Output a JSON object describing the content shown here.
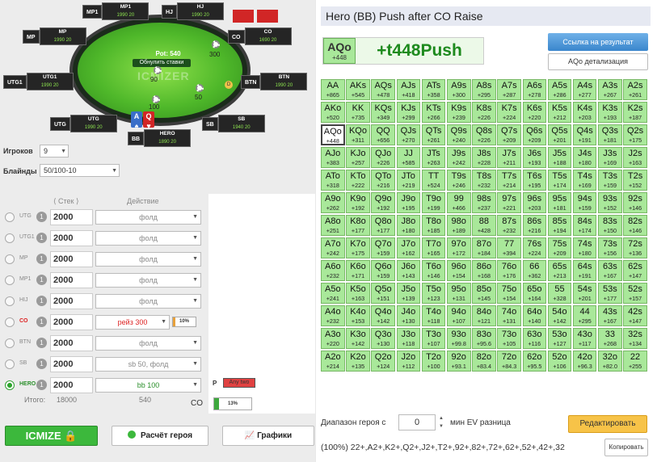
{
  "table": {
    "pot_label": "Pot: 540",
    "reset_label": "Обнулить ставки",
    "watermark": "ICMIZER",
    "seats": [
      {
        "pos": "MP1",
        "name": "MP1",
        "stack": "1990 20"
      },
      {
        "pos": "HJ",
        "name": "HJ",
        "stack": "1990 20"
      },
      {
        "pos": "MP",
        "name": "MP",
        "stack": "1990 20"
      },
      {
        "pos": "CO",
        "name": "CO",
        "stack": "1690 20"
      },
      {
        "pos": "UTG1",
        "name": "UTG1",
        "stack": "1990 20"
      },
      {
        "pos": "BTN",
        "name": "BTN",
        "stack": "1990 20"
      },
      {
        "pos": "UTG",
        "name": "UTG",
        "stack": "1990 20"
      },
      {
        "pos": "SB",
        "name": "SB",
        "stack": "1940 20"
      },
      {
        "pos": "BB",
        "name": "HERO",
        "stack": "1890 20"
      }
    ],
    "chips": {
      "co": "300",
      "btn": "50",
      "hero": "100",
      "mp": "90"
    },
    "hero_cards": [
      "A",
      "Q"
    ]
  },
  "controls": {
    "players_label": "Игроков",
    "players_value": "9",
    "blinds_label": "Блайнды",
    "blinds_value": "50/100-10",
    "stack_header": "Стек",
    "action_header": "Действие"
  },
  "rows": [
    {
      "pos": "UTG",
      "stack": "2000",
      "action": "фолд"
    },
    {
      "pos": "UTG1",
      "stack": "2000",
      "action": "фолд"
    },
    {
      "pos": "MP",
      "stack": "2000",
      "action": "фолд"
    },
    {
      "pos": "MP1",
      "stack": "2000",
      "action": "фолд"
    },
    {
      "pos": "HIJ",
      "stack": "2000",
      "action": "фолд"
    },
    {
      "pos": "CO",
      "stack": "2000",
      "action": "рейз 300",
      "badge": "10%"
    },
    {
      "pos": "BTN",
      "stack": "2000",
      "action": "фолд"
    },
    {
      "pos": "SB",
      "stack": "2000",
      "action": "sb 50, фолд"
    },
    {
      "pos": "HERO",
      "stack": "2000",
      "action": "bb 100"
    }
  ],
  "num1": "1",
  "totals": {
    "label": "Итого:",
    "stack": "18000",
    "action": "540"
  },
  "ranges": {
    "p_label": "P",
    "any_two": "Any two",
    "co_label": "CO",
    "co_badge": "13%"
  },
  "buttons": {
    "icmize": "ICMIZE",
    "hero_calc": "Расчёт героя",
    "charts": "Графики"
  },
  "right": {
    "title": "Hero (BB) Push after CO Raise",
    "hero_hand": "AQo",
    "hero_hand_ev": "+448",
    "hero_ev_big": "+t448Push",
    "link_button": "Ссылка на результат",
    "detail_button": "AQo детализация",
    "range_label": "Диапазон героя с",
    "range_value": "0",
    "ev_label": "мин EV разница",
    "edit_button": "Редактировать",
    "range_text": "(100%) 22+,A2+,K2+,Q2+,J2+,T2+,92+,82+,72+,62+,52+,42+,32",
    "copy_button": "Копировать"
  },
  "colors": {
    "push": "#a9e89a",
    "green": "#2b8f2b",
    "orange": "#f7c348",
    "blue": "#3a86cc",
    "red": "#d12626"
  },
  "grid": [
    [
      "AA",
      "+865"
    ],
    [
      "AKs",
      "+545"
    ],
    [
      "AQs",
      "+478"
    ],
    [
      "AJs",
      "+418"
    ],
    [
      "ATs",
      "+358"
    ],
    [
      "A9s",
      "+300"
    ],
    [
      "A8s",
      "+295"
    ],
    [
      "A7s",
      "+287"
    ],
    [
      "A6s",
      "+278"
    ],
    [
      "A5s",
      "+286"
    ],
    [
      "A4s",
      "+277"
    ],
    [
      "A3s",
      "+267"
    ],
    [
      "A2s",
      "+261"
    ],
    [
      "AKo",
      "+520"
    ],
    [
      "KK",
      "+735"
    ],
    [
      "KQs",
      "+349"
    ],
    [
      "KJs",
      "+299"
    ],
    [
      "KTs",
      "+266"
    ],
    [
      "K9s",
      "+239"
    ],
    [
      "K8s",
      "+226"
    ],
    [
      "K7s",
      "+224"
    ],
    [
      "K6s",
      "+220"
    ],
    [
      "K5s",
      "+212"
    ],
    [
      "K4s",
      "+203"
    ],
    [
      "K3s",
      "+193"
    ],
    [
      "K2s",
      "+187"
    ],
    [
      "AQo",
      "+448"
    ],
    [
      "KQo",
      "+311"
    ],
    [
      "QQ",
      "+656"
    ],
    [
      "QJs",
      "+270"
    ],
    [
      "QTs",
      "+261"
    ],
    [
      "Q9s",
      "+240"
    ],
    [
      "Q8s",
      "+226"
    ],
    [
      "Q7s",
      "+209"
    ],
    [
      "Q6s",
      "+209"
    ],
    [
      "Q5s",
      "+201"
    ],
    [
      "Q4s",
      "+191"
    ],
    [
      "Q3s",
      "+181"
    ],
    [
      "Q2s",
      "+175"
    ],
    [
      "AJo",
      "+383"
    ],
    [
      "KJo",
      "+257"
    ],
    [
      "QJo",
      "+226"
    ],
    [
      "JJ",
      "+585"
    ],
    [
      "JTs",
      "+263"
    ],
    [
      "J9s",
      "+242"
    ],
    [
      "J8s",
      "+228"
    ],
    [
      "J7s",
      "+211"
    ],
    [
      "J6s",
      "+193"
    ],
    [
      "J5s",
      "+188"
    ],
    [
      "J4s",
      "+180"
    ],
    [
      "J3s",
      "+169"
    ],
    [
      "J2s",
      "+163"
    ],
    [
      "ATo",
      "+318"
    ],
    [
      "KTo",
      "+222"
    ],
    [
      "QTo",
      "+216"
    ],
    [
      "JTo",
      "+219"
    ],
    [
      "TT",
      "+524"
    ],
    [
      "T9s",
      "+246"
    ],
    [
      "T8s",
      "+232"
    ],
    [
      "T7s",
      "+214"
    ],
    [
      "T6s",
      "+195"
    ],
    [
      "T5s",
      "+174"
    ],
    [
      "T4s",
      "+169"
    ],
    [
      "T3s",
      "+159"
    ],
    [
      "T2s",
      "+152"
    ],
    [
      "A9o",
      "+262"
    ],
    [
      "K9o",
      "+192"
    ],
    [
      "Q9o",
      "+192"
    ],
    [
      "J9o",
      "+195"
    ],
    [
      "T9o",
      "+199"
    ],
    [
      "99",
      "+466"
    ],
    [
      "98s",
      "+237"
    ],
    [
      "97s",
      "+221"
    ],
    [
      "96s",
      "+203"
    ],
    [
      "95s",
      "+181"
    ],
    [
      "94s",
      "+159"
    ],
    [
      "93s",
      "+152"
    ],
    [
      "92s",
      "+146"
    ],
    [
      "A8o",
      "+251"
    ],
    [
      "K8o",
      "+177"
    ],
    [
      "Q8o",
      "+177"
    ],
    [
      "J8o",
      "+180"
    ],
    [
      "T8o",
      "+185"
    ],
    [
      "98o",
      "+189"
    ],
    [
      "88",
      "+428"
    ],
    [
      "87s",
      "+232"
    ],
    [
      "86s",
      "+216"
    ],
    [
      "85s",
      "+194"
    ],
    [
      "84s",
      "+174"
    ],
    [
      "83s",
      "+150"
    ],
    [
      "82s",
      "+146"
    ],
    [
      "A7o",
      "+242"
    ],
    [
      "K7o",
      "+175"
    ],
    [
      "Q7o",
      "+159"
    ],
    [
      "J7o",
      "+162"
    ],
    [
      "T7o",
      "+165"
    ],
    [
      "97o",
      "+172"
    ],
    [
      "87o",
      "+184"
    ],
    [
      "77",
      "+394"
    ],
    [
      "76s",
      "+224"
    ],
    [
      "75s",
      "+209"
    ],
    [
      "74s",
      "+180"
    ],
    [
      "73s",
      "+156"
    ],
    [
      "72s",
      "+136"
    ],
    [
      "A6o",
      "+232"
    ],
    [
      "K6o",
      "+171"
    ],
    [
      "Q6o",
      "+159"
    ],
    [
      "J6o",
      "+143"
    ],
    [
      "T6o",
      "+146"
    ],
    [
      "96o",
      "+154"
    ],
    [
      "86o",
      "+168"
    ],
    [
      "76o",
      "+176"
    ],
    [
      "66",
      "+362"
    ],
    [
      "65s",
      "+213"
    ],
    [
      "64s",
      "+191"
    ],
    [
      "63s",
      "+167"
    ],
    [
      "62s",
      "+147"
    ],
    [
      "A5o",
      "+241"
    ],
    [
      "K5o",
      "+163"
    ],
    [
      "Q5o",
      "+151"
    ],
    [
      "J5o",
      "+139"
    ],
    [
      "T5o",
      "+123"
    ],
    [
      "95o",
      "+131"
    ],
    [
      "85o",
      "+145"
    ],
    [
      "75o",
      "+154"
    ],
    [
      "65o",
      "+164"
    ],
    [
      "55",
      "+328"
    ],
    [
      "54s",
      "+201"
    ],
    [
      "53s",
      "+177"
    ],
    [
      "52s",
      "+157"
    ],
    [
      "A4o",
      "+232"
    ],
    [
      "K4o",
      "+153"
    ],
    [
      "Q4o",
      "+142"
    ],
    [
      "J4o",
      "+130"
    ],
    [
      "T4o",
      "+118"
    ],
    [
      "94o",
      "+107"
    ],
    [
      "84o",
      "+121"
    ],
    [
      "74o",
      "+131"
    ],
    [
      "64o",
      "+140"
    ],
    [
      "54o",
      "+142"
    ],
    [
      "44",
      "+295"
    ],
    [
      "43s",
      "+167"
    ],
    [
      "42s",
      "+147"
    ],
    [
      "A3o",
      "+220"
    ],
    [
      "K3o",
      "+142"
    ],
    [
      "Q3o",
      "+130"
    ],
    [
      "J3o",
      "+118"
    ],
    [
      "T3o",
      "+107"
    ],
    [
      "93o",
      "+99.8"
    ],
    [
      "83o",
      "+95.6"
    ],
    [
      "73o",
      "+105"
    ],
    [
      "63o",
      "+116"
    ],
    [
      "53o",
      "+127"
    ],
    [
      "43o",
      "+117"
    ],
    [
      "33",
      "+268"
    ],
    [
      "32s",
      "+134"
    ],
    [
      "A2o",
      "+214"
    ],
    [
      "K2o",
      "+135"
    ],
    [
      "Q2o",
      "+124"
    ],
    [
      "J2o",
      "+112"
    ],
    [
      "T2o",
      "+100"
    ],
    [
      "92o",
      "+93.1"
    ],
    [
      "82o",
      "+83.4"
    ],
    [
      "72o",
      "+84.3"
    ],
    [
      "62o",
      "+95.5"
    ],
    [
      "52o",
      "+106"
    ],
    [
      "42o",
      "+96.3"
    ],
    [
      "32o",
      "+82.0"
    ],
    [
      "22",
      "+255"
    ]
  ]
}
